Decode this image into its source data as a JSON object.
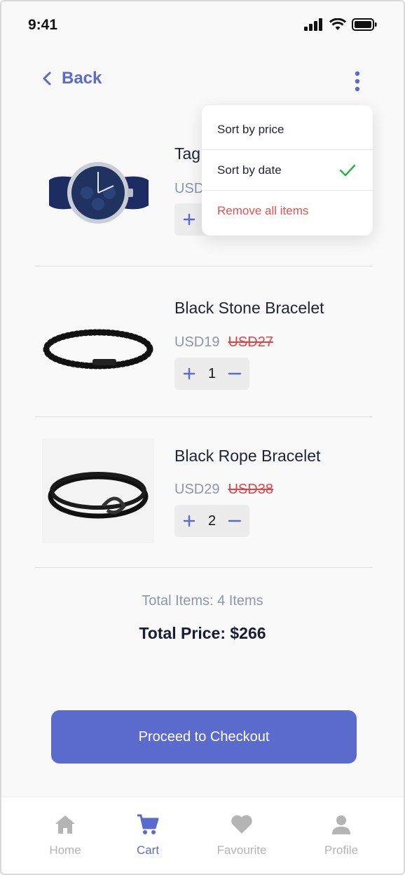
{
  "status_bar": {
    "time": "9:41"
  },
  "header": {
    "back_label": "Back"
  },
  "items": [
    {
      "name": "Tag",
      "price": "USD",
      "old_price": "",
      "quantity": ""
    },
    {
      "name": "Black Stone Bracelet",
      "price": "USD19",
      "old_price": "USD27",
      "quantity": "1"
    },
    {
      "name": "Black Rope Bracelet",
      "price": "USD29",
      "old_price": "USD38",
      "quantity": "2"
    }
  ],
  "totals": {
    "items_label": "Total Items: 4 Items",
    "price_label": "Total Price: $266"
  },
  "checkout": {
    "label": "Proceed to Checkout"
  },
  "nav": {
    "items": [
      {
        "label": "Home",
        "icon": "home-icon"
      },
      {
        "label": "Cart",
        "icon": "cart-icon",
        "active": true
      },
      {
        "label": "Favourite",
        "icon": "heart-icon"
      },
      {
        "label": "Profile",
        "icon": "profile-icon"
      }
    ]
  },
  "menu": {
    "items": [
      {
        "label": "Sort by price"
      },
      {
        "label": "Sort by date",
        "checked": true
      },
      {
        "label": "Remove all items",
        "danger": true
      }
    ]
  },
  "colors": {
    "accent": "#5a6bcd",
    "danger": "#e04545",
    "check": "#27b34a"
  }
}
